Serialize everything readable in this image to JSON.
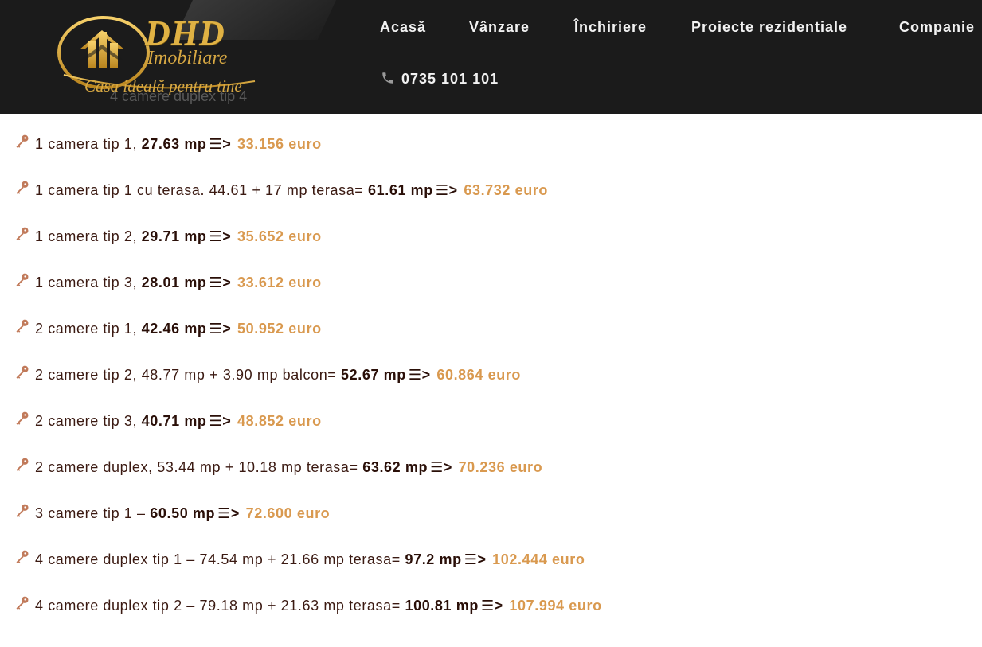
{
  "header": {
    "logo": {
      "brand": "DHD",
      "sub": "Imobiliare",
      "tagline": "Casa ideală pentru tine"
    },
    "ghost_text": "4 camere duplex tip 4",
    "nav": [
      {
        "label": "Acasă"
      },
      {
        "label": "Vânzare"
      },
      {
        "label": "Închiriere"
      },
      {
        "label": "Proiecte rezidentiale"
      },
      {
        "label": "Companie"
      }
    ],
    "phone": "0735 101 101",
    "phone_icon": "phone-icon"
  },
  "colors": {
    "header_bg": "#1b1b1b",
    "gold": "#e0b244",
    "price": "#d9994f",
    "text": "#3b1a12",
    "key_icon": "#c17a5a"
  },
  "list_icon": "key-icon",
  "arrow_symbol": "☰>",
  "listings": [
    {
      "desc": "1 camera tip 1, ",
      "area": "27.63 mp",
      "price": "33.156 euro"
    },
    {
      "desc": "1 camera tip 1 cu terasa. 44.61 + 17 mp terasa= ",
      "area": "61.61 mp",
      "price": "63.732 euro"
    },
    {
      "desc": "1 camera tip 2, ",
      "area": "29.71 mp",
      "price": "35.652 euro"
    },
    {
      "desc": "1 camera tip 3, ",
      "area": "28.01 mp",
      "price": "33.612 euro"
    },
    {
      "desc": "2 camere tip 1, ",
      "area": "42.46 mp",
      "price": "50.952 euro"
    },
    {
      "desc": "2 camere tip 2, 48.77 mp + 3.90 mp balcon= ",
      "area": "52.67 mp",
      "price": "60.864 euro"
    },
    {
      "desc": "2 camere tip 3, ",
      "area": "40.71 mp",
      "price": "48.852 euro"
    },
    {
      "desc": "2 camere duplex, 53.44 mp + 10.18 mp terasa= ",
      "area": "63.62 mp",
      "price": "70.236 euro"
    },
    {
      "desc": "3 camere tip 1 – ",
      "area": "60.50 mp",
      "price": "72.600 euro"
    },
    {
      "desc": "4 camere duplex tip 1 – 74.54 mp + 21.66 mp terasa= ",
      "area": "97.2 mp",
      "price": "102.444 euro"
    },
    {
      "desc": "4 camere duplex tip 2 – 79.18 mp + 21.63 mp terasa= ",
      "area": "100.81 mp",
      "price": "107.994 euro"
    }
  ]
}
